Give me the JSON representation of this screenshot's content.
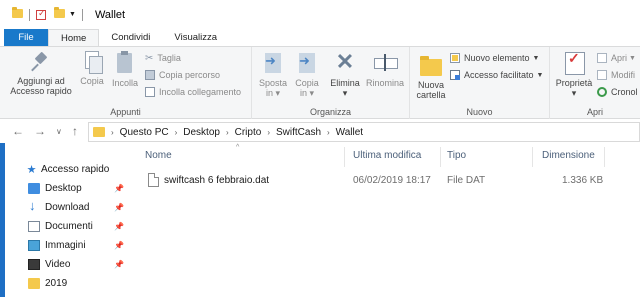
{
  "window": {
    "title": "Wallet"
  },
  "quick_access_toolbar": {
    "icons": [
      "folder-icon",
      "properties-check-icon",
      "folder-icon",
      "dropdown-arrow-icon"
    ]
  },
  "ribbon_tabs": [
    {
      "label": "File"
    },
    {
      "label": "Home"
    },
    {
      "label": "Condividi"
    },
    {
      "label": "Visualizza"
    }
  ],
  "ribbon": {
    "appunti": {
      "label": "Appunti",
      "pin_label_1": "Aggiungi ad",
      "pin_label_2": "Accesso rapido",
      "copy": "Copia",
      "paste": "Incolla",
      "cut": "Taglia",
      "copy_path": "Copia percorso",
      "paste_shortcut": "Incolla collegamento"
    },
    "organizza": {
      "label": "Organizza",
      "move_1": "Sposta",
      "move_2": "in",
      "copy_to_1": "Copia",
      "copy_to_2": "in",
      "delete": "Elimina",
      "rename": "Rinomina"
    },
    "nuovo": {
      "label": "Nuovo",
      "new_folder_1": "Nuova",
      "new_folder_2": "cartella",
      "new_item": "Nuovo elemento",
      "easy_access": "Accesso facilitato"
    },
    "apri": {
      "label": "Apri",
      "properties": "Proprietà",
      "open": "Apri",
      "edit": "Modifi",
      "history": "Cronol"
    }
  },
  "address_bar": {
    "crumbs": [
      "Questo PC",
      "Desktop",
      "Cripto",
      "SwiftCash",
      "Wallet"
    ]
  },
  "nav_pane": {
    "quick_access": "Accesso rapido",
    "items": [
      {
        "label": "Desktop",
        "icon": "desktop-icon",
        "pinned": true
      },
      {
        "label": "Download",
        "icon": "download-icon",
        "pinned": true
      },
      {
        "label": "Documenti",
        "icon": "documents-icon",
        "pinned": true
      },
      {
        "label": "Immagini",
        "icon": "pictures-icon",
        "pinned": true
      },
      {
        "label": "Video",
        "icon": "video-icon",
        "pinned": true
      },
      {
        "label": "2019",
        "icon": "folder-icon",
        "pinned": false
      }
    ]
  },
  "file_list": {
    "columns": [
      "Nome",
      "Ultima modifica",
      "Tipo",
      "Dimensione"
    ],
    "rows": [
      {
        "name": "swiftcash 6 febbraio.dat",
        "modified": "06/02/2019 18:17",
        "type": "File DAT",
        "size": "1.336 KB"
      }
    ]
  },
  "colors": {
    "accent": "#1979ca",
    "folder": "#f4c94c",
    "header_text": "#4c607a"
  }
}
